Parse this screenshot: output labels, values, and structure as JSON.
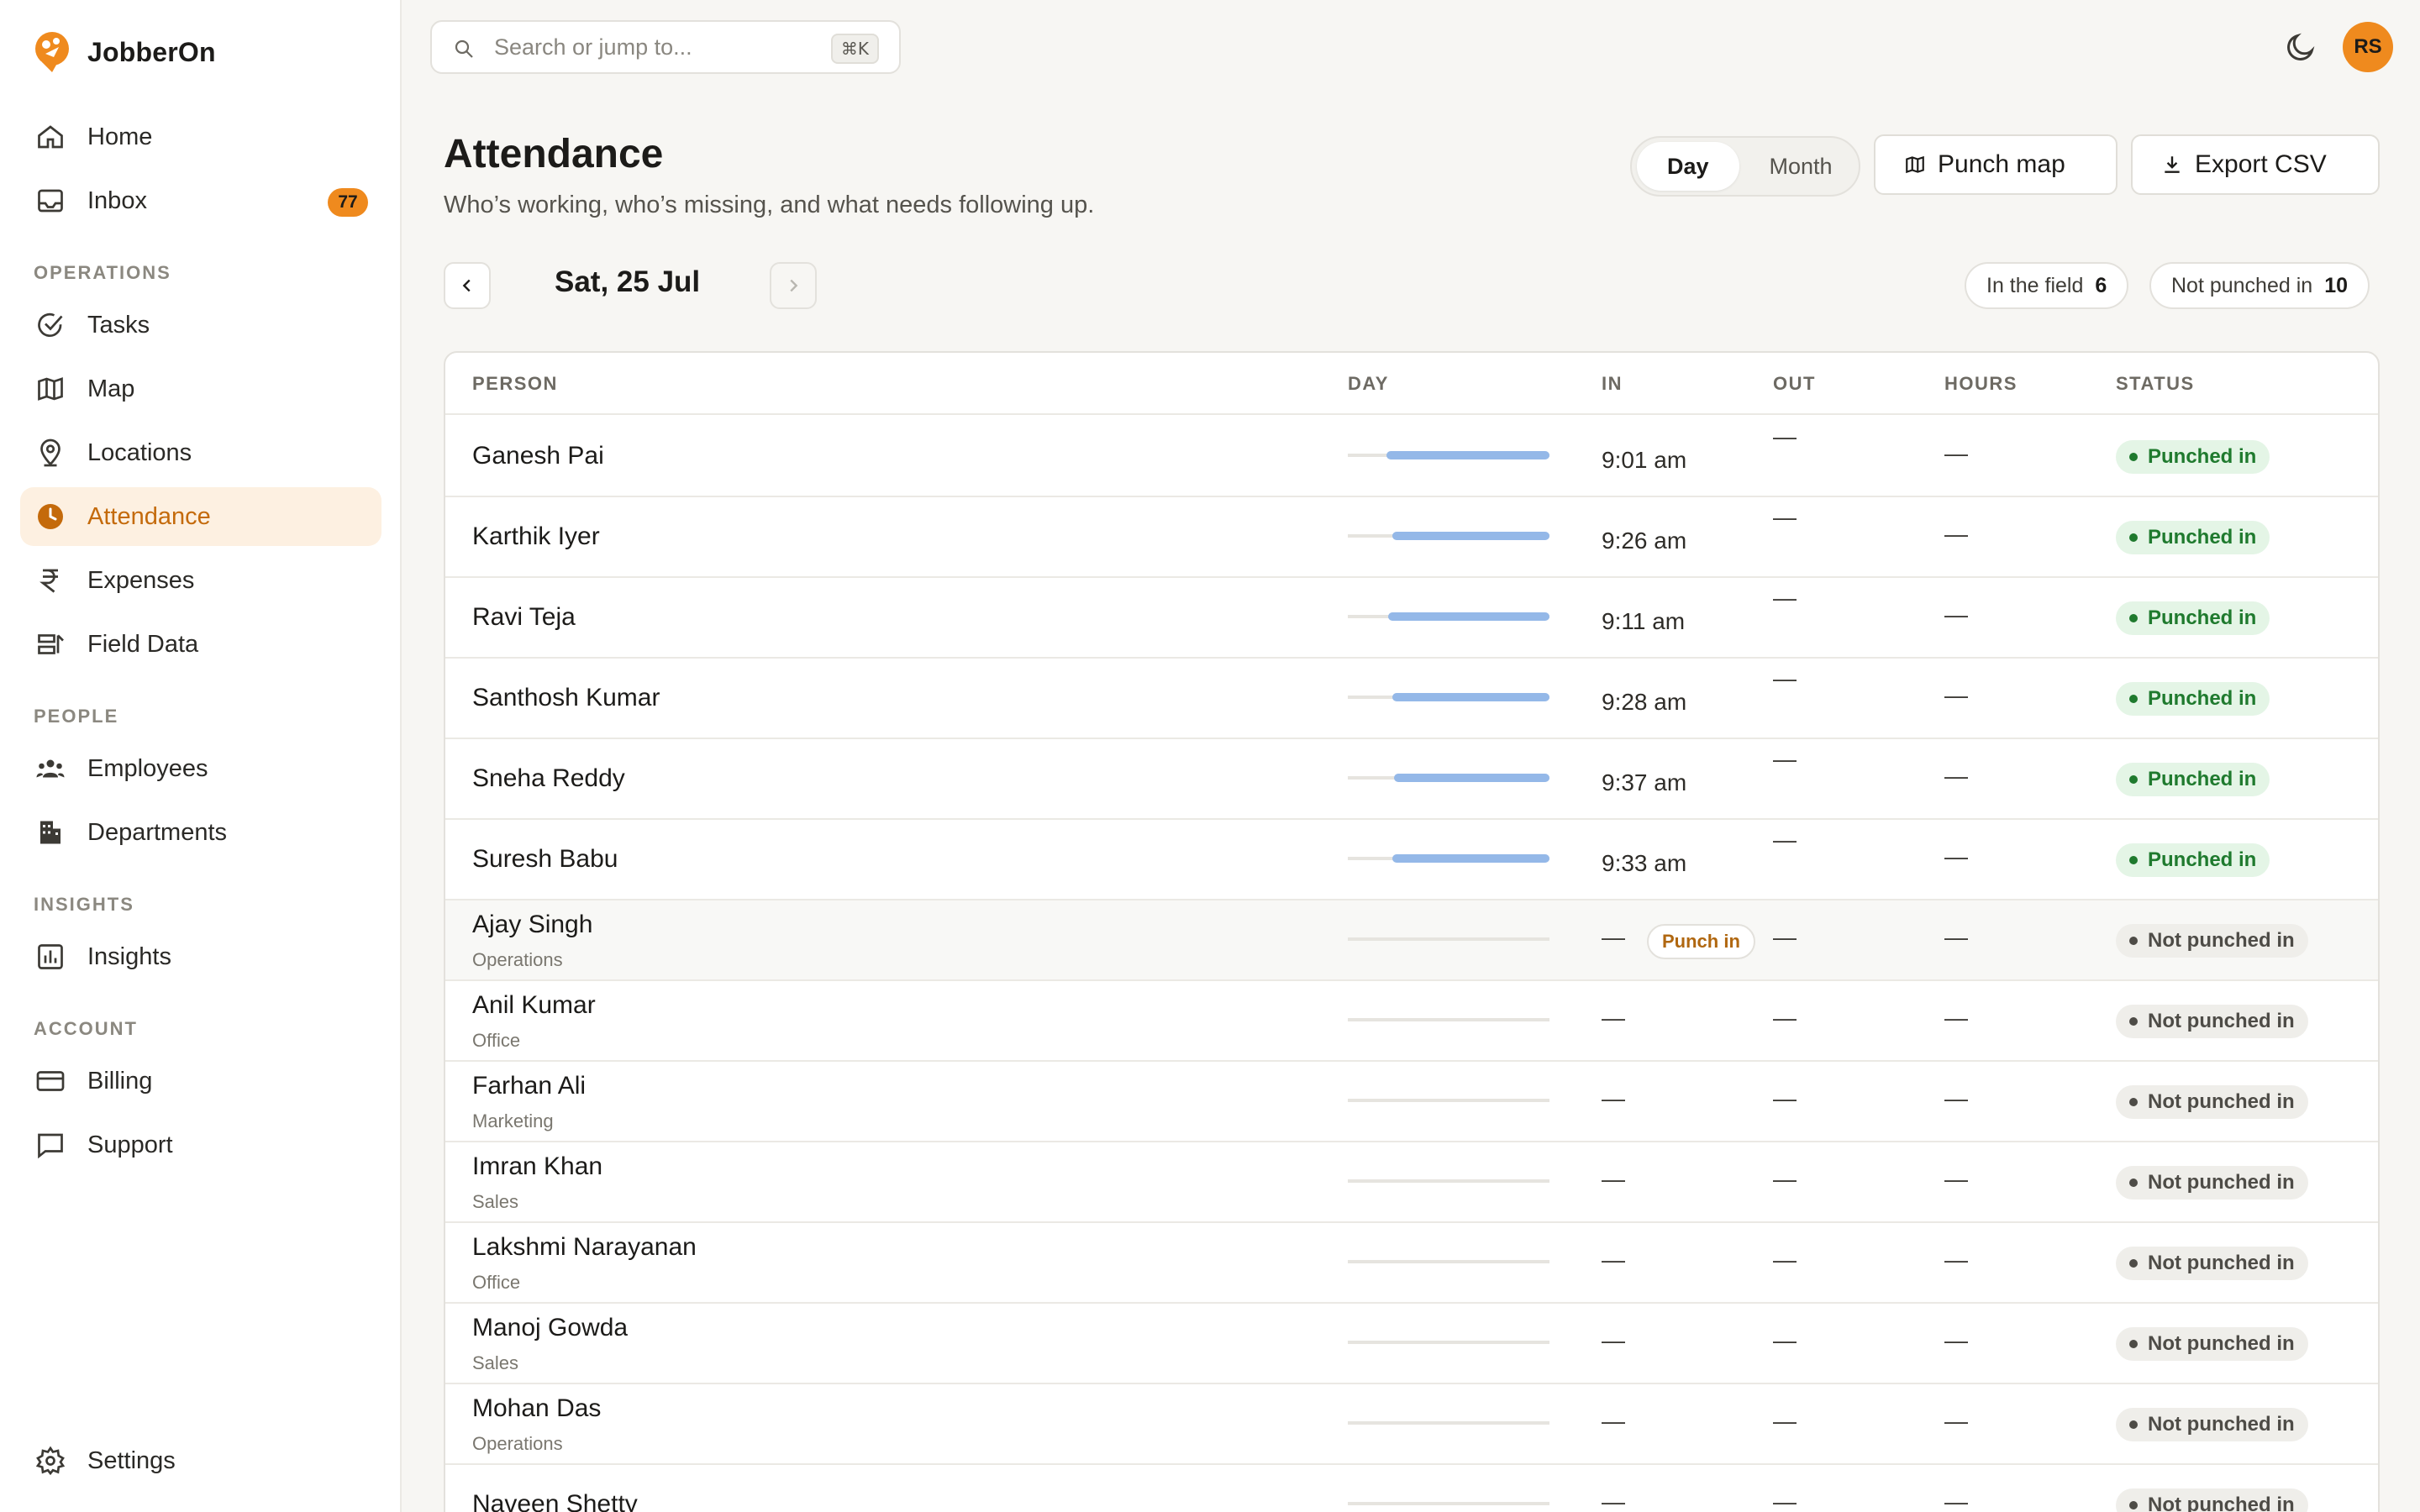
{
  "app": {
    "name": "JobberOn"
  },
  "sidebar": {
    "items": [
      {
        "label": "Home"
      },
      {
        "label": "Inbox",
        "badge": "77"
      },
      {
        "label": "Tasks"
      },
      {
        "label": "Map"
      },
      {
        "label": "Locations"
      },
      {
        "label": "Attendance",
        "active": true
      },
      {
        "label": "Expenses"
      },
      {
        "label": "Field Data"
      },
      {
        "label": "Employees"
      },
      {
        "label": "Departments"
      },
      {
        "label": "Insights"
      },
      {
        "label": "Billing"
      },
      {
        "label": "Support"
      },
      {
        "label": "Settings"
      }
    ],
    "sections": {
      "operations": "OPERATIONS",
      "people": "PEOPLE",
      "insights": "INSIGHTS",
      "account": "ACCOUNT"
    }
  },
  "topbar": {
    "search_placeholder": "Search or jump to...",
    "search_shortcut": "⌘K",
    "avatar_initials": "RS"
  },
  "header": {
    "title": "Attendance",
    "subtitle": "Who’s working, who’s missing, and what needs following up.",
    "view_day": "Day",
    "view_month": "Month",
    "punch_map": "Punch map",
    "export_csv": "Export CSV"
  },
  "date": {
    "label": "Sat, 25 Jul"
  },
  "summary": {
    "in_field_label": "In the field",
    "in_field_count": "6",
    "not_punched_label": "Not punched in",
    "not_punched_count": "10"
  },
  "table": {
    "headers": {
      "person": "PERSON",
      "day": "DAY",
      "in": "IN",
      "out": "OUT",
      "hours": "HOURS",
      "status": "STATUS"
    },
    "dash": "—",
    "punch_in_label": "Punch in",
    "rows": [
      {
        "name": "Ganesh Pai",
        "dept": "",
        "in": "9:01 am",
        "out": "—",
        "hours": "—",
        "status": "Punched in",
        "punched": true,
        "day_start": 0.19
      },
      {
        "name": "Karthik Iyer",
        "dept": "",
        "in": "9:26 am",
        "out": "—",
        "hours": "—",
        "status": "Punched in",
        "punched": true,
        "day_start": 0.22
      },
      {
        "name": "Ravi Teja",
        "dept": "",
        "in": "9:11 am",
        "out": "—",
        "hours": "—",
        "status": "Punched in",
        "punched": true,
        "day_start": 0.2
      },
      {
        "name": "Santhosh Kumar",
        "dept": "",
        "in": "9:28 am",
        "out": "—",
        "hours": "—",
        "status": "Punched in",
        "punched": true,
        "day_start": 0.22
      },
      {
        "name": "Sneha Reddy",
        "dept": "",
        "in": "9:37 am",
        "out": "—",
        "hours": "—",
        "status": "Punched in",
        "punched": true,
        "day_start": 0.23
      },
      {
        "name": "Suresh Babu",
        "dept": "",
        "in": "9:33 am",
        "out": "—",
        "hours": "—",
        "status": "Punched in",
        "punched": true,
        "day_start": 0.22
      },
      {
        "name": "Ajay Singh",
        "dept": "Operations",
        "in": "—",
        "out": "—",
        "hours": "—",
        "status": "Not punched in",
        "punched": false,
        "action": true
      },
      {
        "name": "Anil Kumar",
        "dept": "Office",
        "in": "—",
        "out": "—",
        "hours": "—",
        "status": "Not punched in",
        "punched": false
      },
      {
        "name": "Farhan Ali",
        "dept": "Marketing",
        "in": "—",
        "out": "—",
        "hours": "—",
        "status": "Not punched in",
        "punched": false
      },
      {
        "name": "Imran Khan",
        "dept": "Sales",
        "in": "—",
        "out": "—",
        "hours": "—",
        "status": "Not punched in",
        "punched": false
      },
      {
        "name": "Lakshmi Narayanan",
        "dept": "Office",
        "in": "—",
        "out": "—",
        "hours": "—",
        "status": "Not punched in",
        "punched": false
      },
      {
        "name": "Manoj Gowda",
        "dept": "Sales",
        "in": "—",
        "out": "—",
        "hours": "—",
        "status": "Not punched in",
        "punched": false
      },
      {
        "name": "Mohan Das",
        "dept": "Operations",
        "in": "—",
        "out": "—",
        "hours": "—",
        "status": "Not punched in",
        "punched": false
      },
      {
        "name": "Naveen Shetty",
        "dept": "",
        "in": "—",
        "out": "—",
        "hours": "—",
        "status": "Not punched in",
        "punched": false
      }
    ]
  }
}
